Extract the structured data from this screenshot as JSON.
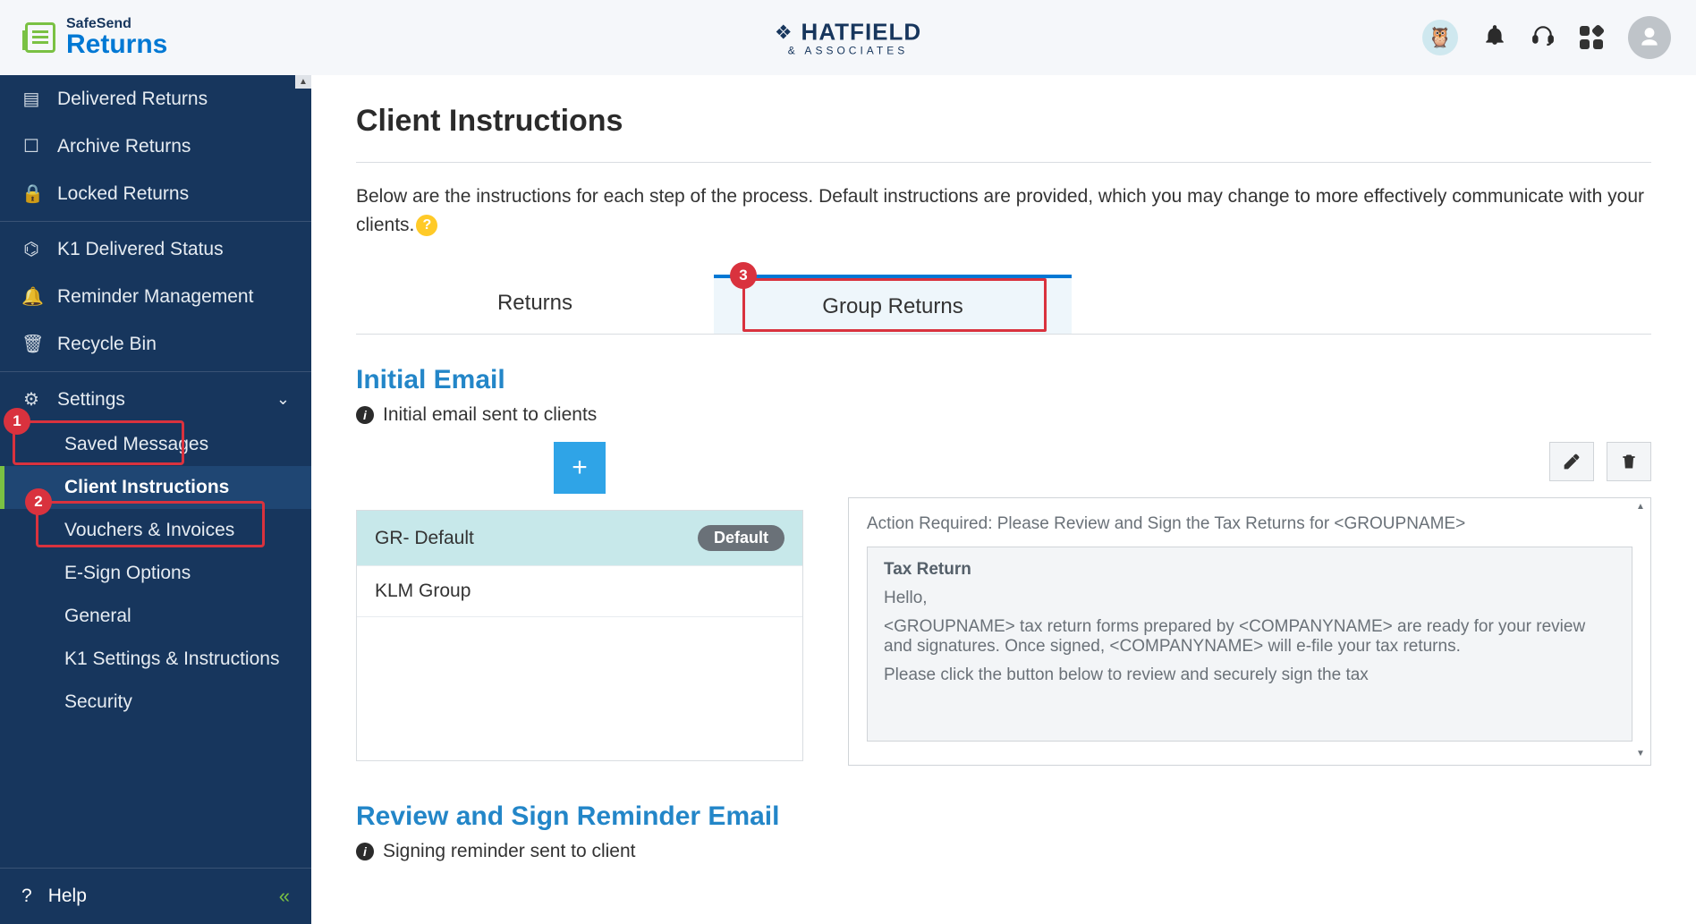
{
  "header": {
    "product_small": "SafeSend",
    "product_big": "Returns",
    "brand_name": "HATFIELD",
    "brand_sub": "& ASSOCIATES"
  },
  "sidebar": {
    "items": {
      "delivered": "Delivered Returns",
      "archive": "Archive Returns",
      "locked": "Locked Returns",
      "k1status": "K1 Delivered Status",
      "reminder": "Reminder Management",
      "recycle": "Recycle Bin",
      "settings": "Settings"
    },
    "settings_children": {
      "saved_messages": "Saved Messages",
      "client_instructions": "Client Instructions",
      "vouchers": "Vouchers & Invoices",
      "esign": "E-Sign Options",
      "general": "General",
      "k1settings": "K1 Settings & Instructions",
      "security": "Security"
    },
    "help": "Help"
  },
  "callouts": {
    "one": "1",
    "two": "2",
    "three": "3"
  },
  "page": {
    "title": "Client Instructions",
    "description": "Below are the instructions for each step of the process. Default instructions are provided, which you may change to more effectively communicate with your clients."
  },
  "tabs": {
    "returns": "Returns",
    "group_returns": "Group Returns"
  },
  "section1": {
    "title": "Initial Email",
    "desc": "Initial email sent to clients",
    "templates": {
      "t1_name": "GR- Default",
      "t1_badge": "Default",
      "t2_name": "KLM Group"
    },
    "preview": {
      "subject": "Action Required: Please Review and Sign the Tax Returns for <GROUPNAME>",
      "body_heading": "Tax Return",
      "body_hello": "Hello,",
      "body_p1": "<GROUPNAME> tax return forms prepared by <COMPANYNAME> are ready for your review and signatures. Once signed, <COMPANYNAME> will e-file your tax returns.",
      "body_p2": "Please click the button below to review and securely sign the tax"
    }
  },
  "section2": {
    "title": "Review and Sign Reminder Email",
    "desc": "Signing reminder sent to client"
  }
}
